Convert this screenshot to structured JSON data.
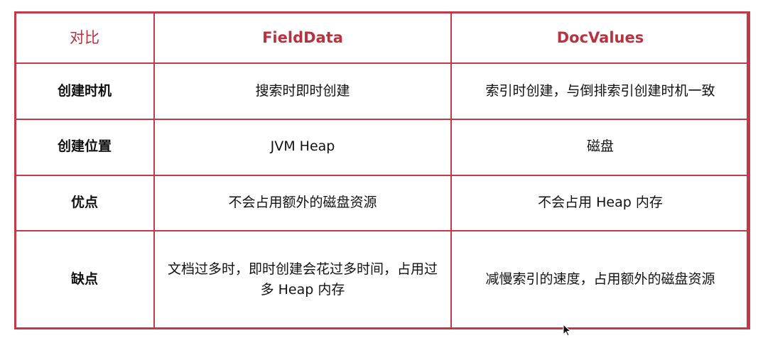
{
  "table": {
    "headers": [
      "对比",
      "FieldData",
      "DocValues"
    ],
    "rows": [
      {
        "label": "创建时机",
        "fielddata": "搜索时即时创建",
        "docvalues": "索引时创建，与倒排索引创建时机一致"
      },
      {
        "label": "创建位置",
        "fielddata": "JVM Heap",
        "docvalues": "磁盘"
      },
      {
        "label": "优点",
        "fielddata": "不会占用额外的磁盘资源",
        "docvalues": "不会占用 Heap 内存"
      },
      {
        "label": "缺点",
        "fielddata": "文档过多时，即时创建会花过多时间，占用过多 Heap 内存",
        "docvalues": "减慢索引的速度，占用额外的磁盘资源"
      }
    ]
  },
  "colors": {
    "border": "#c23a4a",
    "header_text": "#b8323f",
    "body_text": "#111111"
  }
}
